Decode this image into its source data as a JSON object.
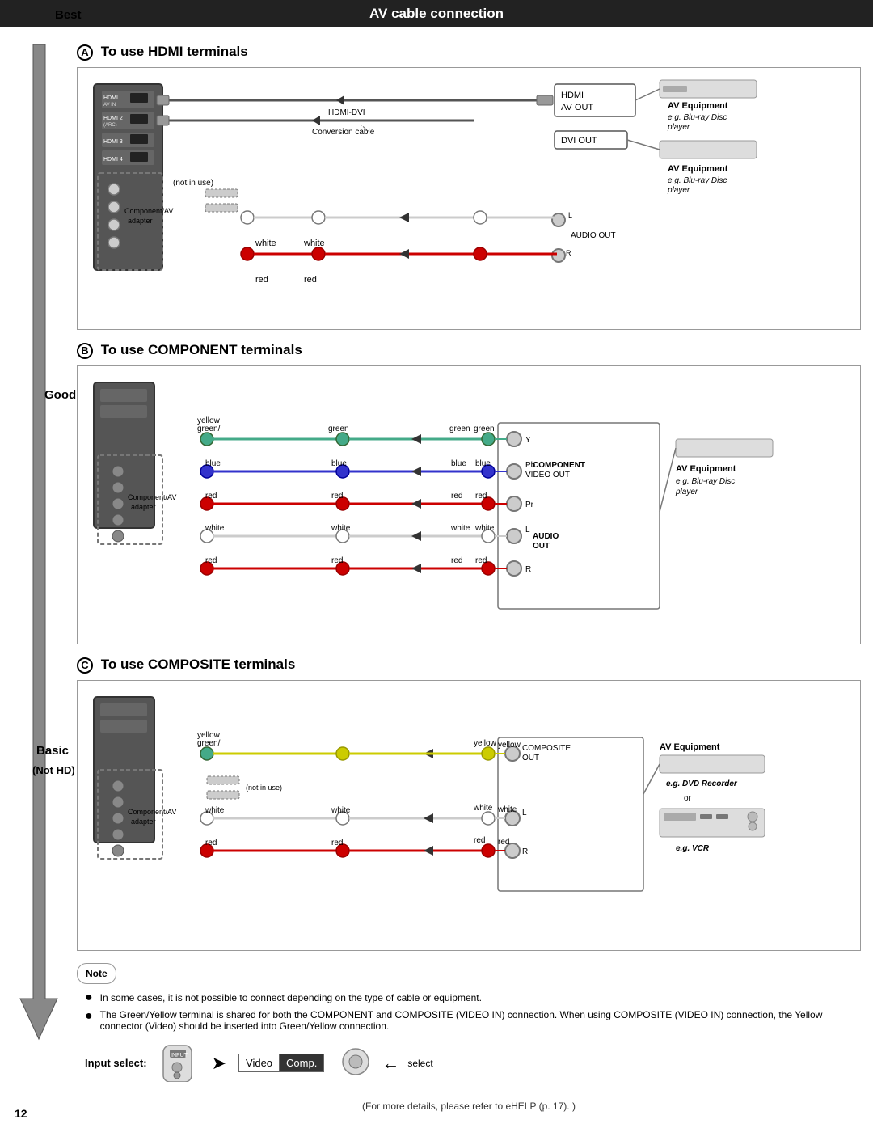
{
  "page": {
    "title": "AV cable connection",
    "page_number": "12",
    "footer_note": "(For more details, please refer to eHELP (p. 17). )"
  },
  "quality_labels": {
    "best": "Best",
    "good": "Good",
    "basic": "Basic",
    "not_hd": "(Not HD)"
  },
  "section_a": {
    "letter": "A",
    "title": "To use HDMI terminals",
    "hdmi_ports": [
      "HDMI AV IN HDMI 1",
      "HDMI 2 (ARC)",
      "HDMI 3",
      "HDMI 4"
    ],
    "not_in_use": "not in use",
    "adapter_label": "Component/AV adapter",
    "cable_label": "HDMI-DVI Conversion cable",
    "colors_left": [
      "white",
      "red",
      "white",
      "red"
    ],
    "colors_right_top": [
      "white",
      "red"
    ],
    "hdmi_box": "HDMI AV OUT",
    "dvi_box": "DVI OUT",
    "audio_box": "L\nR AUDIO OUT",
    "eq1_label": "AV Equipment",
    "eq1_sub": "e.g. Blu-ray Disc player",
    "eq2_label": "AV Equipment",
    "eq2_sub": "e.g. Blu-ray Disc player"
  },
  "section_b": {
    "letter": "B",
    "title": "To use COMPONENT terminals",
    "adapter_label": "Component/AV adapter",
    "colors_tv": [
      "green/yellow",
      "blue",
      "red",
      "white",
      "red"
    ],
    "colors_mid_left": [
      "green",
      "blue",
      "red",
      "white",
      "red"
    ],
    "colors_mid_right": [
      "green",
      "blue",
      "red",
      "white",
      "red"
    ],
    "colors_eq": [
      "green",
      "blue",
      "red",
      "white",
      "red"
    ],
    "component_labels": [
      "Y",
      "Pb COMPONENT VIDEO OUT",
      "Pr",
      "L AUDIO",
      "R OUT"
    ],
    "eq_label": "AV Equipment",
    "eq_sub": "e.g. Blu-ray Disc player"
  },
  "section_c": {
    "letter": "C",
    "title": "To use COMPOSITE terminals",
    "adapter_label": "Component/AV adapter",
    "not_in_use": "(not in use)",
    "colors_tv": [
      "green/yellow",
      "white",
      "red"
    ],
    "colors_mid": [
      "yellow",
      "white",
      "red"
    ],
    "colors_eq": [
      "yellow",
      "white",
      "red"
    ],
    "composite_labels": [
      "COMPOSITE OUT",
      "L",
      "R"
    ],
    "eq_label": "AV Equipment",
    "eq_sub1": "e.g. DVD Recorder",
    "eq_sub2": "or",
    "eq_sub3": "e.g. VCR"
  },
  "note": {
    "label": "Note",
    "items": [
      "In some cases, it is not possible to connect depending on the type of cable or equipment.",
      "The Green/Yellow terminal is shared for both the COMPONENT and COMPOSITE (VIDEO IN) connection. When using COMPOSITE (VIDEO IN) connection, the Yellow connector (Video) should be inserted into Green/Yellow connection."
    ]
  },
  "input_select": {
    "label": "Input select:",
    "input_label": "INPUT",
    "video_label": "Video",
    "comp_label": "Comp.",
    "select_label": "select"
  }
}
